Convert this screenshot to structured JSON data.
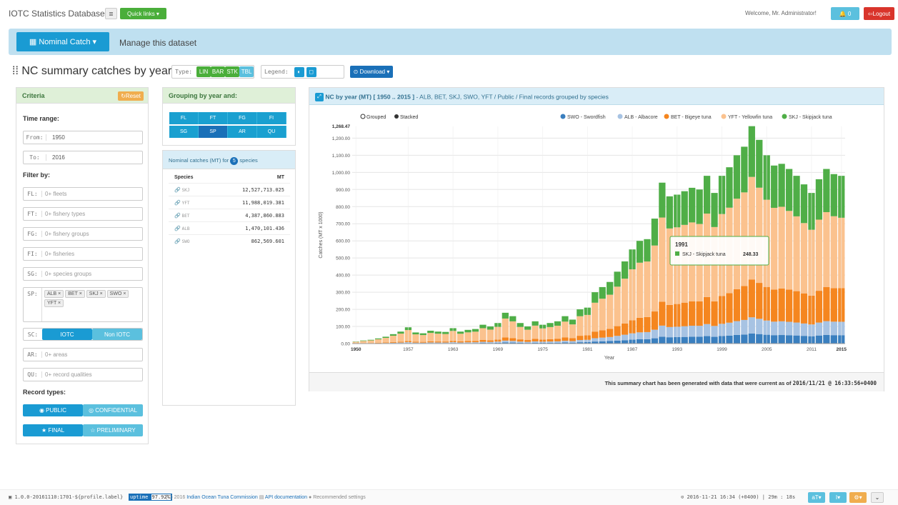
{
  "app": {
    "title": "IOTC Statistics Database",
    "quick_links": "Quick links ▾",
    "welcome": "Welcome, Mr. Administrator!",
    "notif_count": "0",
    "logout": "Logout"
  },
  "nav": {
    "dataset_btn": "Nominal Catch ▾",
    "manage": "Manage this dataset"
  },
  "page": {
    "title": "NC summary catches by year",
    "type_label": "Type:",
    "types": [
      "LIN",
      "BAR",
      "STK",
      "TBL"
    ],
    "legend_label": "Legend:",
    "download": "Download ▾"
  },
  "criteria": {
    "title": "Criteria",
    "reset": "Reset",
    "time_range": "Time range:",
    "from_label": "From:",
    "from_value": "1950",
    "to_label": "To:",
    "to_value": "2016",
    "filter_by": "Filter by:",
    "filters": [
      {
        "code": "FL:",
        "placeholder": "0+ fleets"
      },
      {
        "code": "FT:",
        "placeholder": "0+ fishery types"
      },
      {
        "code": "FG:",
        "placeholder": "0+ fishery groups"
      },
      {
        "code": "FI:",
        "placeholder": "0+ fisheries"
      },
      {
        "code": "SG:",
        "placeholder": "0+ species groups"
      }
    ],
    "sp_label": "SP:",
    "sp_tags": [
      "ALB ×",
      "BET ×",
      "SKJ ×",
      "SWO ×",
      "YFT ×"
    ],
    "sc_label": "SC:",
    "sc_options": [
      "IOTC",
      "Non IOTC"
    ],
    "filters2": [
      {
        "code": "AR:",
        "placeholder": "0+ areas"
      },
      {
        "code": "QU:",
        "placeholder": "0+ record qualities"
      }
    ],
    "record_types": "Record types:",
    "rt_row1": [
      "PUBLIC",
      "CONFIDENTIAL"
    ],
    "rt_row2": [
      "FINAL",
      "PRELIMINARY"
    ]
  },
  "grouping": {
    "title": "Grouping by year and:",
    "row1": [
      "FL",
      "FT",
      "FG",
      "FI"
    ],
    "row2": [
      "SG",
      "SP",
      "AR",
      "QU"
    ]
  },
  "nominal": {
    "title_pre": "Nominal catches (MT) for",
    "count": "5",
    "title_post": "species",
    "col_species": "Species",
    "col_mt": "MT",
    "rows": [
      {
        "sp": "SKJ",
        "mt": "12,527,713.025"
      },
      {
        "sp": "YFT",
        "mt": "11,988,019.381"
      },
      {
        "sp": "BET",
        "mt": "4,387,860.883"
      },
      {
        "sp": "ALB",
        "mt": "1,470,101.436"
      },
      {
        "sp": "SWO",
        "mt": "862,569.601"
      }
    ]
  },
  "chart_panel": {
    "title_bold": "NC by year (MT) [ 1950 .. 2015 ]",
    "title_rest": " - ALB, BET, SKJ, SWO, YFT / Public / Final records grouped by species",
    "footer_pre": "This summary chart has been generated with data that were current as of",
    "footer_ts": "2016/11/21 @ 16:33:56+0400",
    "mode_grouped": "Grouped",
    "mode_stacked": "Stacked"
  },
  "tooltip": {
    "year": "1991",
    "label": "SKJ - Skipjack tuna",
    "value": "248.33"
  },
  "chart_data": {
    "type": "bar",
    "stacked": true,
    "xlabel": "Year",
    "ylabel": "Catches (MT x 1000)",
    "ylim": [
      0,
      1268.47
    ],
    "y_max_label": "1,268.47",
    "yticks": [
      "0.00",
      "100.00",
      "200.00",
      "300.00",
      "400.00",
      "500.00",
      "600.00",
      "700.00",
      "800.00",
      "900.00",
      "1,000.00",
      "1,100.00",
      "1,200.00"
    ],
    "xticks": [
      "1950",
      "1957",
      "1963",
      "1969",
      "1975",
      "1981",
      "1987",
      "1993",
      "1999",
      "2005",
      "2011",
      "2015"
    ],
    "legend_position": "top-right",
    "series_meta": [
      {
        "name": "SWO - Swordfish",
        "color": "#3a7fbf"
      },
      {
        "name": "ALB - Albacore",
        "color": "#a7c3e3"
      },
      {
        "name": "BET - Bigeye tuna",
        "color": "#f5861f"
      },
      {
        "name": "YFT - Yellowfin tuna",
        "color": "#fbc28e"
      },
      {
        "name": "SKJ - Skipjack tuna",
        "color": "#4fae47"
      }
    ],
    "totals": [
      12,
      18,
      22,
      30,
      40,
      55,
      70,
      95,
      65,
      60,
      75,
      70,
      68,
      90,
      70,
      80,
      85,
      110,
      100,
      120,
      180,
      160,
      120,
      100,
      130,
      110,
      120,
      130,
      160,
      140,
      200,
      210,
      300,
      330,
      360,
      420,
      480,
      550,
      600,
      610,
      730,
      940,
      860,
      870,
      890,
      910,
      900,
      980,
      880,
      980,
      1030,
      1100,
      1150,
      1270,
      1190,
      1100,
      1040,
      1050,
      1020,
      980,
      930,
      880,
      960,
      1020,
      990,
      980
    ]
  },
  "footer": {
    "version": "1.0.0-20161110:1701-${profile.label}",
    "uptime_label": "uptime",
    "uptime_value": "97.92%",
    "copyright": "(C) 2016",
    "org": "Indian Ocean Tuna Commission",
    "api": "API documentation",
    "recommended": "Recommended settings",
    "clock": "2016-11-21 16:34 (+0400) | 29m : 18s"
  }
}
